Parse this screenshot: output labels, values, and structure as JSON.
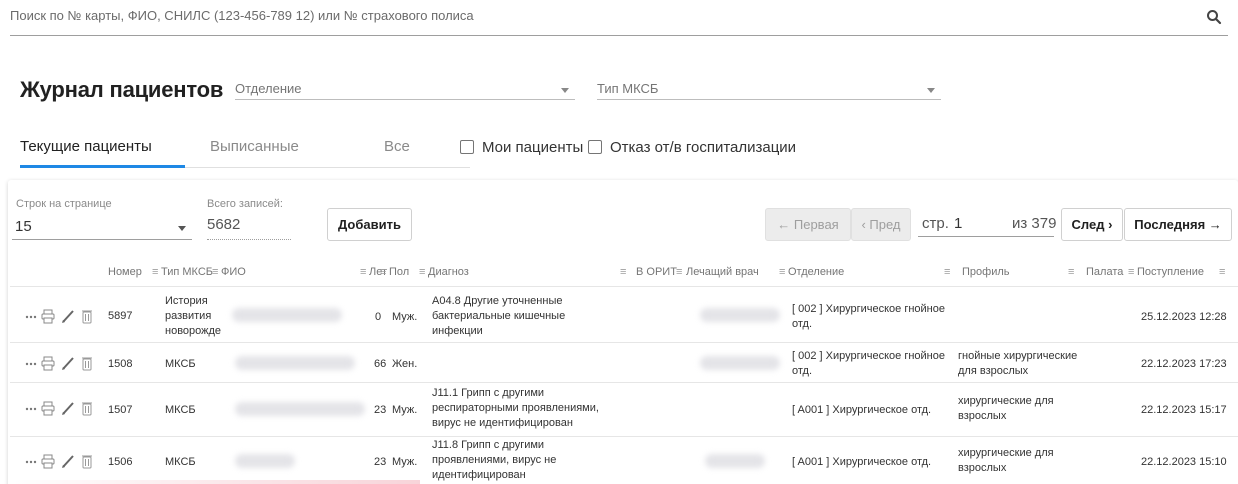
{
  "search": {
    "placeholder": "Поиск по № карты, ФИО, СНИЛС (123-456-789 12) или № страхового полиса",
    "icon": "search-icon"
  },
  "header": {
    "title": "Журнал пациентов",
    "department_select": "Отделение",
    "mksb_type_select": "Тип МКСБ"
  },
  "tabs": [
    {
      "label": "Текущие пациенты",
      "active": true
    },
    {
      "label": "Выписанные",
      "active": false
    },
    {
      "label": "Все",
      "active": false
    }
  ],
  "checkboxes": [
    {
      "label": "Мои пациенты",
      "checked": false
    },
    {
      "label": "Отказ от/в госпитализации",
      "checked": false
    }
  ],
  "toolbar": {
    "rows_per_page_label": "Строк на странице",
    "rows_per_page_value": "15",
    "total_label": "Всего записей:",
    "total_value": "5682",
    "add_button": "Добавить",
    "first_button": "← Первая",
    "prev_button": "‹ Пред",
    "page_prefix": "стр.",
    "page_value": "1",
    "page_of": "из 379",
    "next_button": "След ›",
    "last_button": "Последняя →"
  },
  "table": {
    "columns": [
      "Номер",
      "Тип МКСБ",
      "ФИО",
      "Лет",
      "Пол",
      "Диагноз",
      "В ОРИТ",
      "Лечащий врач",
      "Отделение",
      "Профиль",
      "Палата",
      "Поступление"
    ],
    "rows": [
      {
        "number": "5897",
        "type_lines": [
          "История",
          "развития",
          "новорожденн"
        ],
        "age": "0",
        "sex": "Муж.",
        "diagnosis_lines": [
          "A04.8 Другие уточненные",
          "бактериальные кишечные",
          "инфекции"
        ],
        "department_lines": [
          "[ 002 ] Хирургическое гнойное",
          "отд."
        ],
        "profile_lines": [],
        "admission": "25.12.2023 12:28"
      },
      {
        "number": "1508",
        "type_lines": [
          "МКСБ"
        ],
        "age": "66",
        "sex": "Жен.",
        "diagnosis_lines": [],
        "department_lines": [
          "[ 002 ] Хирургическое гнойное",
          "отд."
        ],
        "profile_lines": [
          "гнойные хирургические",
          "для взрослых"
        ],
        "admission": "22.12.2023 17:23"
      },
      {
        "number": "1507",
        "type_lines": [
          "МКСБ"
        ],
        "age": "23",
        "sex": "Муж.",
        "diagnosis_lines": [
          "J11.1 Грипп с другими",
          "респираторными проявлениями,",
          "вирус не идентифицирован"
        ],
        "department_lines": [
          "[ A001 ] Хирургическое отд."
        ],
        "profile_lines": [
          "хирургические для",
          "взрослых"
        ],
        "admission": "22.12.2023 15:17"
      },
      {
        "number": "1506",
        "type_lines": [
          "МКСБ"
        ],
        "age": "23",
        "sex": "Муж.",
        "diagnosis_lines": [
          "J11.8 Грипп с другими",
          "проявлениями, вирус не",
          "идентифицирован"
        ],
        "department_lines": [
          "[ A001 ] Хирургическое отд."
        ],
        "profile_lines": [
          "хирургические для",
          "взрослых"
        ],
        "admission": "22.12.2023 15:10"
      }
    ]
  },
  "row_action_icons": [
    "more-icon",
    "print-icon",
    "edit-icon",
    "delete-icon"
  ],
  "colors": {
    "accent": "#1e88e5",
    "text": "#212121",
    "muted": "#8a8a8a"
  }
}
